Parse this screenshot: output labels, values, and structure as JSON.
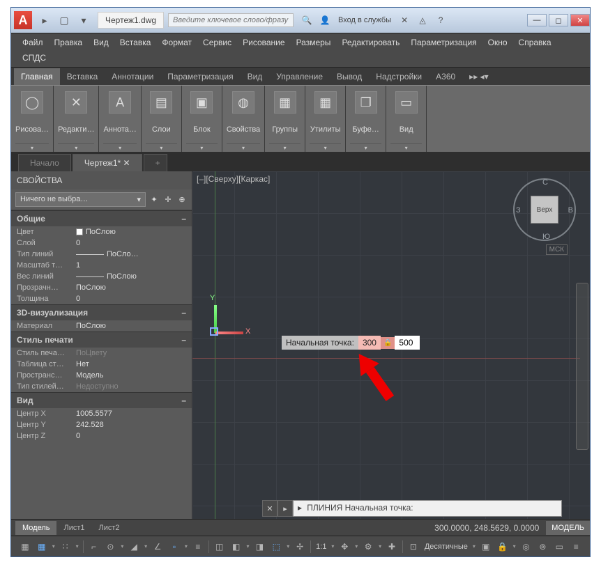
{
  "titlebar": {
    "app_letter": "A",
    "doc_title": "Чертеж1.dwg",
    "search_placeholder": "Введите ключевое слово/фразу",
    "signin": "Вход в службы"
  },
  "menubar": [
    "Файл",
    "Правка",
    "Вид",
    "Вставка",
    "Формат",
    "Сервис",
    "Рисование",
    "Размеры",
    "Редактировать",
    "Параметризация",
    "Окно",
    "Справка",
    "СПДС"
  ],
  "ribbon_tabs": [
    "Главная",
    "Вставка",
    "Аннотации",
    "Параметризация",
    "Вид",
    "Управление",
    "Вывод",
    "Надстройки",
    "A360"
  ],
  "ribbon_active": 0,
  "panels": [
    {
      "label": "Рисова…",
      "icon": "◯"
    },
    {
      "label": "Редакти…",
      "icon": "✕"
    },
    {
      "label": "Аннота…",
      "icon": "A"
    },
    {
      "label": "Слои",
      "icon": "▤"
    },
    {
      "label": "Блок",
      "icon": "▣"
    },
    {
      "label": "Свойства",
      "icon": "◍"
    },
    {
      "label": "Группы",
      "icon": "▦"
    },
    {
      "label": "Утилиты",
      "icon": "▦"
    },
    {
      "label": "Буфе…",
      "icon": "❐"
    },
    {
      "label": "Вид",
      "icon": "▭"
    }
  ],
  "doc_tabs": [
    {
      "label": "Начало",
      "active": false
    },
    {
      "label": "Чертеж1*",
      "active": true
    }
  ],
  "props": {
    "title": "СВОЙСТВА",
    "selection": "Ничего не выбра…",
    "sections": {
      "general": {
        "title": "Общие",
        "rows": [
          {
            "k": "Цвет",
            "v": "ПоСлою",
            "swatch": true
          },
          {
            "k": "Слой",
            "v": "0"
          },
          {
            "k": "Тип линий",
            "v": "ПоСло…",
            "line": true
          },
          {
            "k": "Масштаб т…",
            "v": "1"
          },
          {
            "k": "Вес линий",
            "v": "ПоСлою",
            "line": true
          },
          {
            "k": "Прозрачн…",
            "v": "ПоСлою"
          },
          {
            "k": "Толщина",
            "v": "0"
          }
        ]
      },
      "viz": {
        "title": "3D-визуализация",
        "rows": [
          {
            "k": "Материал",
            "v": "ПоСлою"
          }
        ]
      },
      "plot": {
        "title": "Стиль печати",
        "rows": [
          {
            "k": "Стиль печа…",
            "v": "ПоЦвету",
            "dim": true
          },
          {
            "k": "Таблица ст…",
            "v": "Нет"
          },
          {
            "k": "Пространс…",
            "v": "Модель"
          },
          {
            "k": "Тип стилей…",
            "v": "Недоступно",
            "dim": true
          }
        ]
      },
      "view": {
        "title": "Вид",
        "rows": [
          {
            "k": "Центр X",
            "v": "1005.5577"
          },
          {
            "k": "Центр Y",
            "v": "242.528"
          },
          {
            "k": "Центр Z",
            "v": "0"
          }
        ]
      }
    }
  },
  "canvas": {
    "viewport_label": "[–][Сверху][Каркас]",
    "viewcube": {
      "face": "Верх",
      "n": "С",
      "s": "Ю",
      "e": "В",
      "w": "З"
    },
    "ucs_label": "МСК",
    "tooltip": {
      "label": "Начальная точка:",
      "val1": "300",
      "val2": "500"
    },
    "y_label": "Y",
    "x_label": "X"
  },
  "cmdline": "ПЛИНИЯ Начальная точка:",
  "bottom_tabs": [
    "Модель",
    "Лист1",
    "Лист2"
  ],
  "bottom_active": 0,
  "coords": "300.0000, 248.5629, 0.0000",
  "model_btn": "МОДЕЛЬ",
  "status_scale": "1:1",
  "status_units": "Десятичные"
}
